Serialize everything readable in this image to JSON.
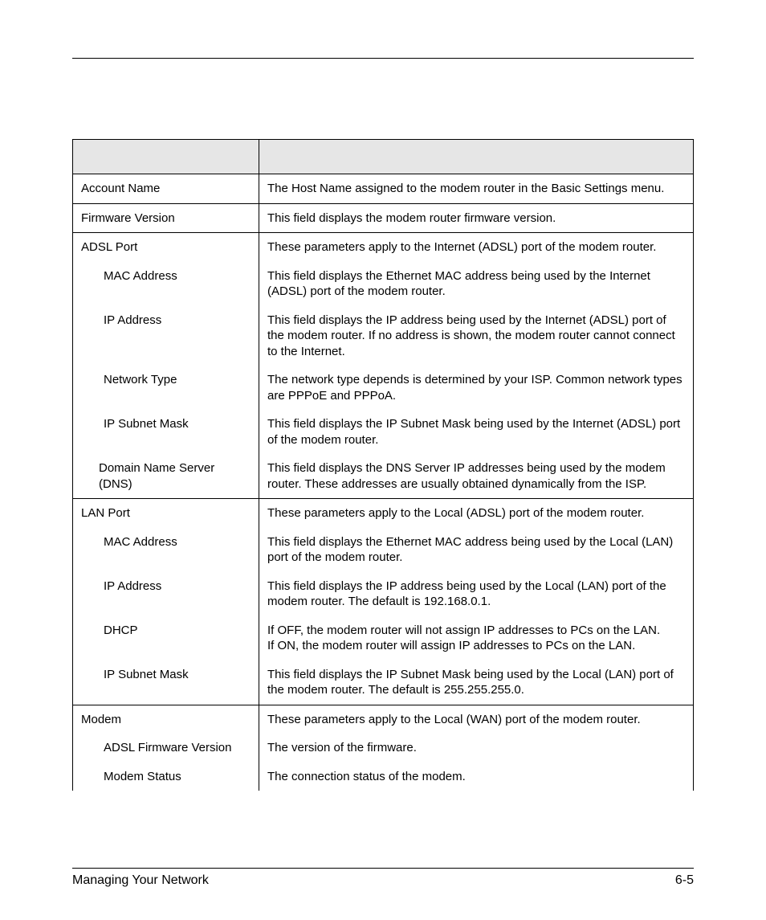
{
  "footer": {
    "section": "Managing Your Network",
    "page": "6-5"
  },
  "rows": [
    {
      "field": "Account Name",
      "indent": 0,
      "desc": "The Host Name assigned to the modem router in the Basic Settings menu.",
      "newgroup": true
    },
    {
      "field": "Firmware Version",
      "indent": 0,
      "desc": "This field displays the modem router firmware version.",
      "newgroup": true
    },
    {
      "field": "ADSL Port",
      "indent": 0,
      "desc": "These parameters apply to the Internet (ADSL) port of the modem router.",
      "newgroup": true
    },
    {
      "field": "MAC Address",
      "indent": 1,
      "desc": "This field displays the Ethernet MAC address being used by the Internet (ADSL) port of the modem router.",
      "newgroup": false
    },
    {
      "field": "IP Address",
      "indent": 1,
      "desc": "This field displays the IP address being used by the Internet (ADSL) port of the modem router. If no address is shown, the modem router cannot connect to the Internet.",
      "newgroup": false
    },
    {
      "field": "Network Type",
      "indent": 1,
      "desc": "The network type depends is determined by your ISP. Common network types are PPPoE and PPPoA.",
      "newgroup": false
    },
    {
      "field": "IP Subnet Mask",
      "indent": 1,
      "desc": "This field displays the IP Subnet Mask being used by the Internet (ADSL) port of the modem router.",
      "newgroup": false
    },
    {
      "field": "Domain Name Server (DNS)",
      "indent": 2,
      "desc": "This field displays the DNS Server IP addresses being used by the modem router. These addresses are usually obtained dynamically from the ISP.",
      "newgroup": false
    },
    {
      "field": "LAN Port",
      "indent": 0,
      "desc": "These parameters apply to the Local (ADSL) port of the modem router.",
      "newgroup": true
    },
    {
      "field": "MAC Address",
      "indent": 1,
      "desc": "This field displays the Ethernet MAC address being used by the Local (LAN) port of the modem router.",
      "newgroup": false
    },
    {
      "field": "IP Address",
      "indent": 1,
      "desc": "This field displays the IP address being used by the Local (LAN) port of the modem router. The default is 192.168.0.1.",
      "newgroup": false
    },
    {
      "field": "DHCP",
      "indent": 1,
      "desc": "If OFF, the modem router will not assign IP addresses to PCs on the LAN.\nIf ON, the modem router will assign IP addresses to PCs on the LAN.",
      "newgroup": false
    },
    {
      "field": "IP Subnet Mask",
      "indent": 1,
      "desc": "This field displays the IP Subnet Mask being used by the Local (LAN) port of the modem router. The default is 255.255.255.0.",
      "newgroup": false
    },
    {
      "field": "Modem",
      "indent": 0,
      "desc": "These parameters apply to the Local (WAN) port of the modem router.",
      "newgroup": true
    },
    {
      "field": "ADSL Firmware Version",
      "indent": 1,
      "desc": "The version of the firmware.",
      "newgroup": false
    },
    {
      "field": "Modem Status",
      "indent": 1,
      "desc": "The connection status of the modem.",
      "newgroup": false
    }
  ]
}
